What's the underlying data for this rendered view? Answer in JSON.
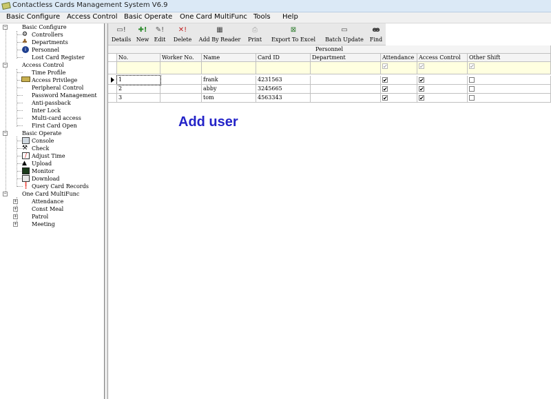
{
  "window": {
    "title": "Contactless Cards Management System  V6.9"
  },
  "menu": [
    "Basic Configure",
    "Access Control",
    "Basic Operate",
    "One Card MultiFunc",
    "Tools",
    "Help"
  ],
  "tree": {
    "basic_configure": {
      "label": "Basic Configure",
      "items": [
        "Controllers",
        "Departments",
        "Personnel",
        "Lost Card Register"
      ]
    },
    "access_control": {
      "label": "Access Control",
      "items": [
        "Time Profile",
        "Access Privilege",
        "Peripheral Control",
        "Password Management",
        "Anti-passback",
        "Inter Lock",
        "Multi-card access",
        "First Card Open"
      ]
    },
    "basic_operate": {
      "label": "Basic Operate",
      "items": [
        "Console",
        "Check",
        "Adjust Time",
        "Upload",
        "Monitor",
        "Download",
        "Query Card Records"
      ]
    },
    "one_card": {
      "label": "One Card MultiFunc",
      "items": [
        "Attendance",
        "Const Meal",
        "Patrol",
        "Meeting"
      ]
    }
  },
  "toolbar": {
    "details": "Details",
    "new": "New",
    "edit": "Edit",
    "delete": "Delete",
    "add_by_reader": "Add By Reader",
    "print": "Print",
    "export": "Export To Excel",
    "batch_update": "Batch Update",
    "find": "Find"
  },
  "grid": {
    "group_header": "Personnel",
    "columns": [
      "No.",
      "Worker No.",
      "Name",
      "Card ID",
      "Department",
      "Attendance",
      "Access Control",
      "Other Shift"
    ],
    "rows": [
      {
        "no": "1",
        "worker_no": "",
        "name": "frank",
        "card_id": "4231563",
        "department": "",
        "attendance": true,
        "access_control": true,
        "other_shift": false
      },
      {
        "no": "2",
        "worker_no": "",
        "name": "abby",
        "card_id": "3245665",
        "department": "",
        "attendance": true,
        "access_control": true,
        "other_shift": false
      },
      {
        "no": "3",
        "worker_no": "",
        "name": "tom",
        "card_id": "4563343",
        "department": "",
        "attendance": true,
        "access_control": true,
        "other_shift": false
      }
    ],
    "check_mark": "✔"
  },
  "overlay": {
    "caption": "Add user"
  },
  "colors": {
    "caption": "#2323c8",
    "titlebar": "#dbe9f6",
    "filter_row": "#ffffe0"
  }
}
